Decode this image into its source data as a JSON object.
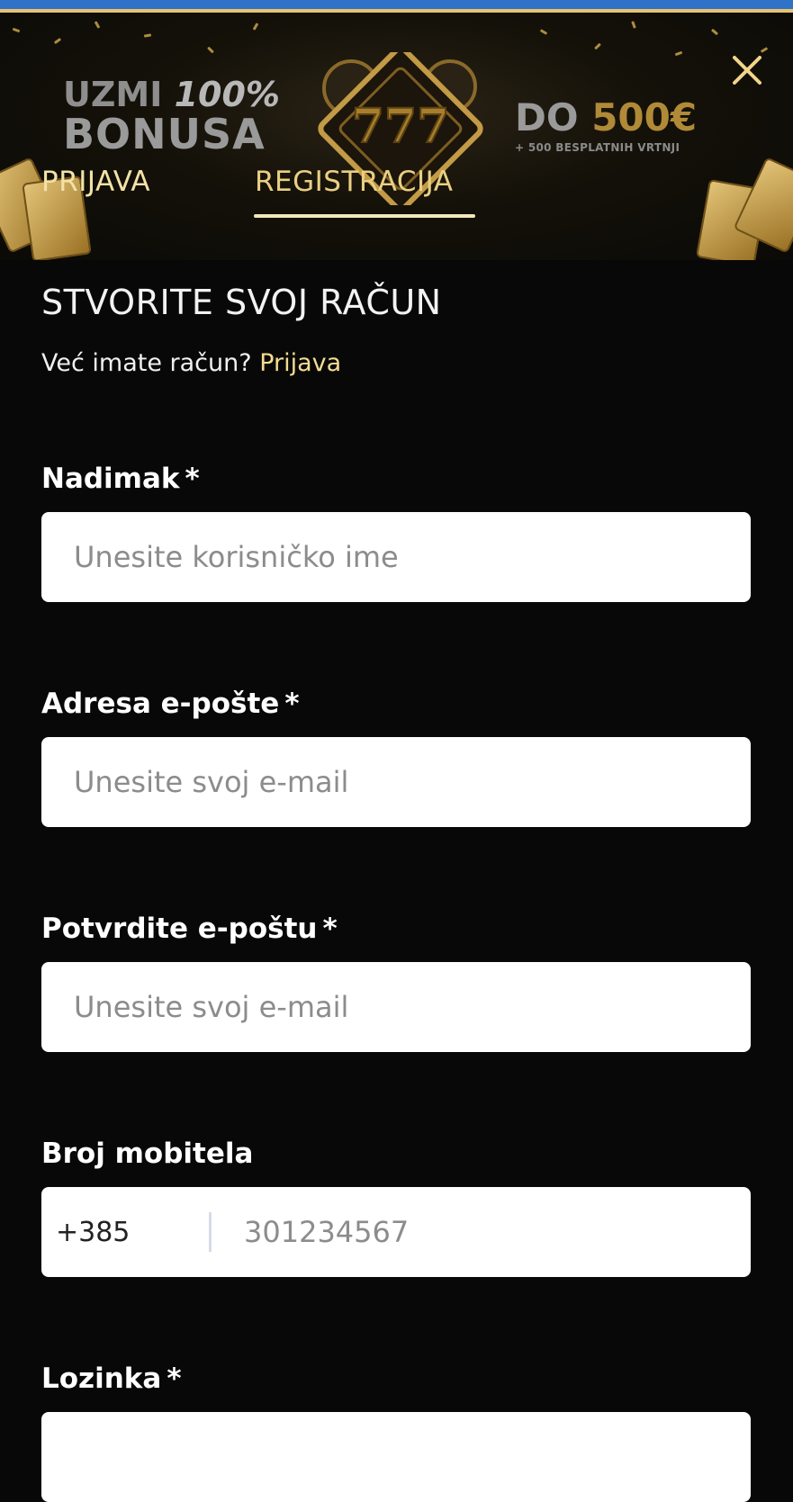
{
  "banner": {
    "promo_line1_a": "UZMI",
    "promo_line1_b": "100%",
    "promo_line2": "BONUSA",
    "promo_right_a": "DO",
    "promo_right_b": "500€",
    "promo_right_small": "+ 500 BESPLATNIH VRTNJI",
    "slot_text": "777"
  },
  "tabs": [
    {
      "label": "PRIJAVA"
    },
    {
      "label": "REGISTRACIJA"
    }
  ],
  "form": {
    "heading": "STVORITE SVOJ RAČUN",
    "subline_text": "Već imate račun?",
    "subline_link": "Prijava",
    "required_mark": "*",
    "fields": {
      "nickname": {
        "label": "Nadimak",
        "placeholder": "Unesite korisničko ime"
      },
      "email": {
        "label": "Adresa e-pošte",
        "placeholder": "Unesite svoj e-mail"
      },
      "email_confirm": {
        "label": "Potvrdite e-poštu",
        "placeholder": "Unesite svoj e-mail"
      },
      "phone": {
        "label": "Broj mobitela",
        "code": "+385",
        "placeholder": "301234567"
      },
      "password": {
        "label": "Lozinka"
      }
    }
  },
  "icons": {
    "close": "close-icon"
  },
  "colors": {
    "accent": "#f3dc92",
    "background": "#080808",
    "top_bar": "#2f72c8"
  }
}
